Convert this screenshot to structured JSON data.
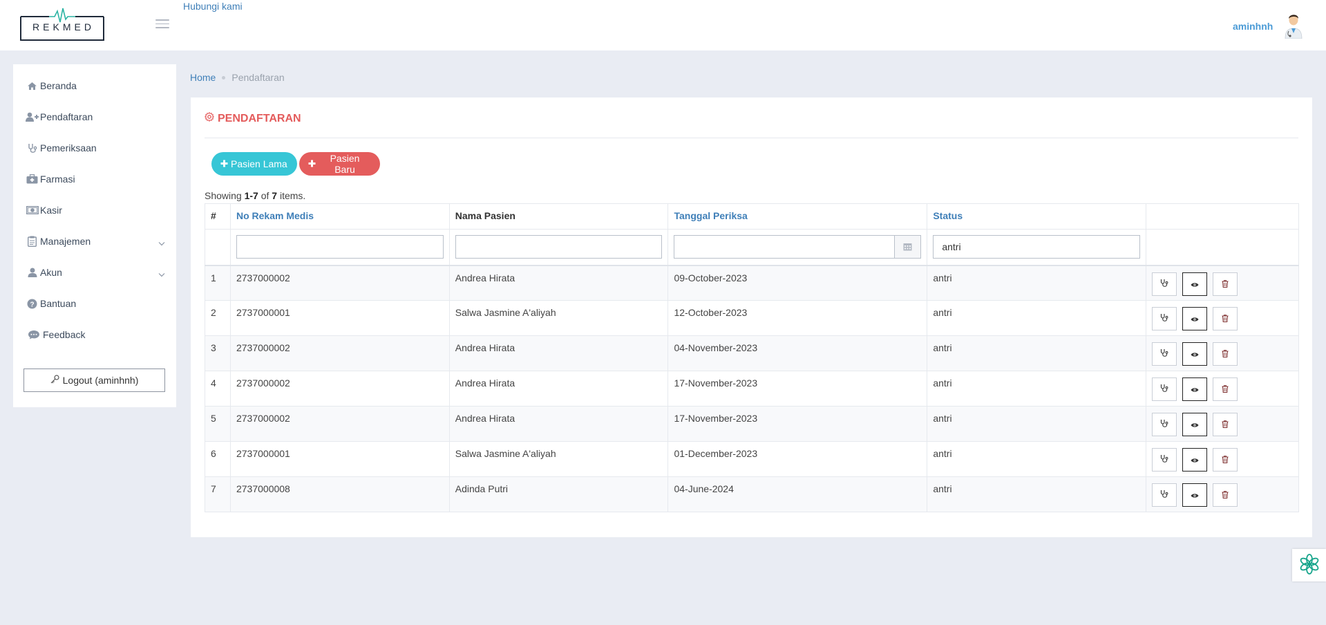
{
  "brand": {
    "name": "REKMED",
    "accent": "#2bb3a3"
  },
  "header": {
    "contact_link": "Hubungi kami",
    "username": "aminhnh",
    "avatar_icon": "doctor-avatar-icon"
  },
  "sidebar": {
    "items": [
      {
        "label": "Beranda",
        "icon": "home-icon"
      },
      {
        "label": "Pendaftaran",
        "icon": "user-plus-icon"
      },
      {
        "label": "Pemeriksaan",
        "icon": "stethoscope-icon"
      },
      {
        "label": "Farmasi",
        "icon": "medkit-icon"
      },
      {
        "label": "Kasir",
        "icon": "money-icon"
      },
      {
        "label": "Manajemen",
        "icon": "clipboard-icon",
        "has_submenu": true
      },
      {
        "label": "Akun",
        "icon": "user-icon",
        "has_submenu": true
      },
      {
        "label": "Bantuan",
        "icon": "question-icon"
      },
      {
        "label": "Feedback",
        "icon": "comment-icon"
      }
    ],
    "logout_label": "Logout (aminhnh)"
  },
  "breadcrumb": {
    "home": "Home",
    "current": "Pendaftaran"
  },
  "panel": {
    "title": "PENDAFTARAN",
    "buttons": {
      "pasien_lama": "Pasien Lama",
      "pasien_baru": "Pasien Baru"
    },
    "summary": {
      "prefix": "Showing ",
      "range": "1-7",
      "of": " of ",
      "total": "7",
      "suffix": " items."
    }
  },
  "table": {
    "columns": [
      "#",
      "No Rekam Medis",
      "Nama Pasien",
      "Tanggal Periksa",
      "Status",
      ""
    ],
    "filters": {
      "no_rekam_medis": "",
      "nama_pasien": "",
      "tanggal_periksa": "",
      "status": "antri"
    },
    "rows": [
      {
        "no": "1",
        "rekam": "2737000002",
        "nama": "Andrea Hirata",
        "tanggal": "09-October-2023",
        "status": "antri"
      },
      {
        "no": "2",
        "rekam": "2737000001",
        "nama": "Salwa Jasmine A'aliyah",
        "tanggal": "12-October-2023",
        "status": "antri"
      },
      {
        "no": "3",
        "rekam": "2737000002",
        "nama": "Andrea Hirata",
        "tanggal": "04-November-2023",
        "status": "antri"
      },
      {
        "no": "4",
        "rekam": "2737000002",
        "nama": "Andrea Hirata",
        "tanggal": "17-November-2023",
        "status": "antri"
      },
      {
        "no": "5",
        "rekam": "2737000002",
        "nama": "Andrea Hirata",
        "tanggal": "17-November-2023",
        "status": "antri"
      },
      {
        "no": "6",
        "rekam": "2737000001",
        "nama": "Salwa Jasmine A'aliyah",
        "tanggal": "01-December-2023",
        "status": "antri"
      },
      {
        "no": "7",
        "rekam": "2737000008",
        "nama": "Adinda Putri",
        "tanggal": "04-June-2024",
        "status": "antri"
      }
    ]
  },
  "colors": {
    "title_red": "#e45c5c",
    "pill_cyan": "#37c6d6",
    "link_blue": "#3f7fb8"
  }
}
